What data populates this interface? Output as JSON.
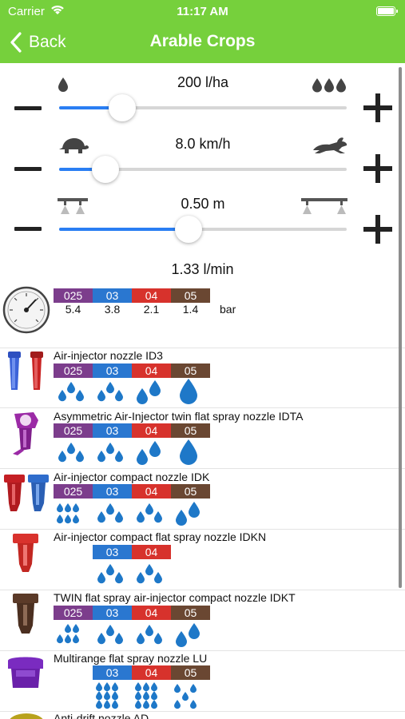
{
  "status": {
    "carrier": "Carrier",
    "time": "11:17 AM"
  },
  "nav": {
    "back_label": "Back",
    "title": "Arable Crops"
  },
  "sliders": [
    {
      "id": "application-rate",
      "value_label": "200 l/ha",
      "value_fraction": 0.22,
      "left_icon": "single-drop-icon",
      "right_icon": "three-drops-icon"
    },
    {
      "id": "speed",
      "value_label": "8.0 km/h",
      "value_fraction": 0.16,
      "left_icon": "turtle-icon",
      "right_icon": "rabbit-icon"
    },
    {
      "id": "nozzle-spacing",
      "value_label": "0.50 m",
      "value_fraction": 0.45,
      "left_icon": "narrow-boom-icon",
      "right_icon": "wide-boom-icon"
    }
  ],
  "flow_rate": "1.33 l/min",
  "pressure": {
    "sizes": [
      "025",
      "03",
      "04",
      "05"
    ],
    "values": [
      "5.4",
      "3.8",
      "2.1",
      "1.4"
    ],
    "unit": "bar"
  },
  "colors": {
    "accent": "#76d03c",
    "slider": "#2a7ef3",
    "size_025": "#7c3d8c",
    "size_03": "#2a77d0",
    "size_04": "#d7322c",
    "size_05": "#6a4732",
    "drop": "#1e78c8"
  },
  "nozzles": [
    {
      "name": "Air-injector nozzle ID3",
      "sizes": [
        "025",
        "03",
        "04",
        "05"
      ]
    },
    {
      "name": "Asymmetric Air-Injector twin flat spray nozzle IDTA",
      "sizes": [
        "025",
        "03",
        "04",
        "05"
      ]
    },
    {
      "name": "Air-injector compact nozzle IDK",
      "sizes": [
        "025",
        "03",
        "04",
        "05"
      ]
    },
    {
      "name": "Air-injector compact flat spray nozzle IDKN",
      "sizes": [
        "03",
        "04"
      ]
    },
    {
      "name": "TWIN flat spray air-injector compact nozzle IDKT",
      "sizes": [
        "025",
        "03",
        "04",
        "05"
      ]
    },
    {
      "name": "Multirange flat spray nozzle LU",
      "sizes": [
        "03",
        "04",
        "05"
      ]
    },
    {
      "name": "Anti-drift nozzle AD",
      "sizes": []
    }
  ]
}
